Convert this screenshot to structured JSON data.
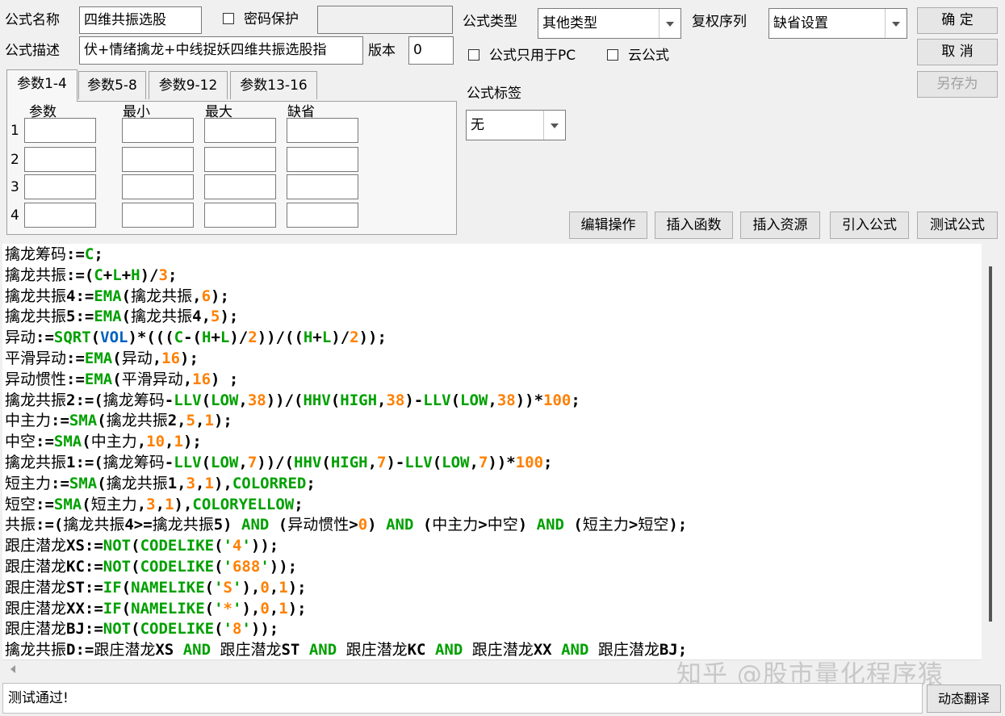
{
  "form": {
    "name_label": "公式名称",
    "name_value": "四维共振选股",
    "password_label": "密码保护",
    "desc_label": "公式描述",
    "desc_value": "伏+情绪擒龙+中线捉妖四维共振选股指",
    "version_label": "版本",
    "version_value": "0",
    "type_label": "公式类型",
    "type_value": "其他类型",
    "rights_label": "复权序列",
    "rights_value": "缺省设置",
    "pc_only_label": "公式只用于PC",
    "cloud_label": "云公式",
    "tag_label": "公式标签",
    "tag_value": "无"
  },
  "buttons": {
    "ok": "确  定",
    "cancel": "取  消",
    "save_as": "另存为",
    "edit_ops": "编辑操作",
    "insert_func": "插入函数",
    "insert_res": "插入资源",
    "import_formula": "引入公式",
    "test_formula": "测试公式",
    "dynamic_translate": "动态翻译"
  },
  "params": {
    "tabs": [
      "参数1-4",
      "参数5-8",
      "参数9-12",
      "参数13-16"
    ],
    "headers": [
      "参数",
      "最小",
      "最大",
      "缺省"
    ],
    "rows": [
      "1",
      "2",
      "3",
      "4"
    ]
  },
  "code_lines": [
    "擒龙筹码:=C;",
    "擒龙共振:=(C+L+H)/3;",
    "擒龙共振4:=EMA(擒龙共振,6);",
    "擒龙共振5:=EMA(擒龙共振4,5);",
    "异动:=SQRT(VOL)*(((C-(H+L)/2))/((H+L)/2));",
    "平滑异动:=EMA(异动,16);",
    "异动惯性:=EMA(平滑异动,16) ;",
    "擒龙共振2:=(擒龙筹码-LLV(LOW,38))/(HHV(HIGH,38)-LLV(LOW,38))*100;",
    "中主力:=SMA(擒龙共振2,5,1);",
    "中空:=SMA(中主力,10,1);",
    "擒龙共振1:=(擒龙筹码-LLV(LOW,7))/(HHV(HIGH,7)-LLV(LOW,7))*100;",
    "短主力:=SMA(擒龙共振1,3,1),COLORRED;",
    "短空:=SMA(短主力,3,1),COLORYELLOW;",
    "共振:=(擒龙共振4>=擒龙共振5) AND (异动惯性>0) AND (中主力>中空) AND (短主力>短空);",
    "跟庄潜龙XS:=NOT(CODELIKE('4'));",
    "跟庄潜龙KC:=NOT(CODELIKE('688'));",
    "跟庄潜龙ST:=IF(NAMELIKE('S'),0,1);",
    "跟庄潜龙XX:=IF(NAMELIKE('*'),0,1);",
    "跟庄潜龙BJ:=NOT(CODELIKE('8'));",
    "擒龙共振D:=跟庄潜龙XS AND 跟庄潜龙ST AND 跟庄潜龙KC AND 跟庄潜龙XX AND 跟庄潜龙BJ;"
  ],
  "status": "测试通过!",
  "watermark": "知乎 @股市量化程序猿",
  "colors": {
    "function": "#00a000",
    "number": "#ff8000",
    "variable": "#0060c0"
  }
}
